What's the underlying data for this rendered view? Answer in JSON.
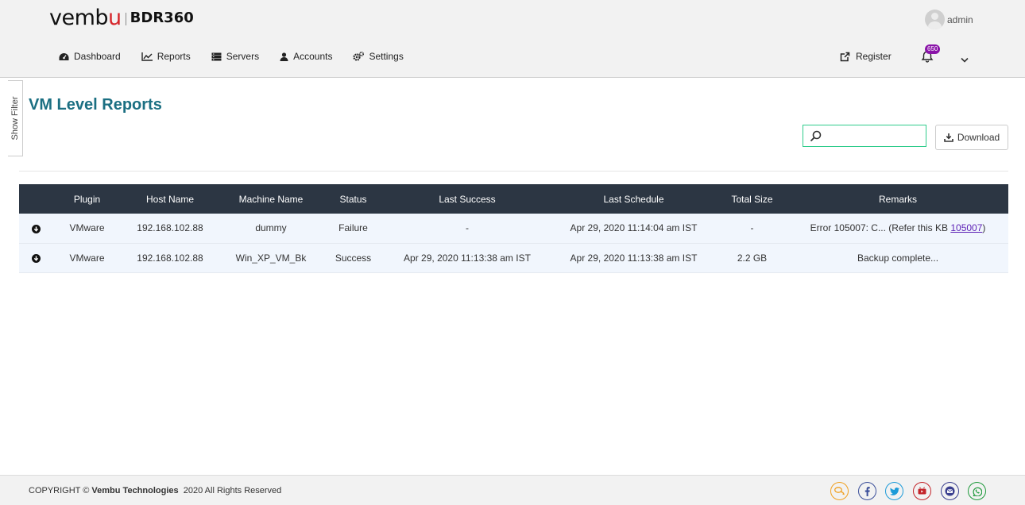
{
  "header": {
    "logo_text_left": "vemb",
    "logo_text_u": "u",
    "logo_product": "BDR360",
    "user_name": "admin"
  },
  "nav": {
    "items": [
      {
        "label": "Dashboard",
        "icon": "dashboard-icon"
      },
      {
        "label": "Reports",
        "icon": "line-chart-icon"
      },
      {
        "label": "Servers",
        "icon": "server-icon"
      },
      {
        "label": "Accounts",
        "icon": "user-icon"
      },
      {
        "label": "Settings",
        "icon": "cogs-icon"
      }
    ],
    "register_label": "Register",
    "notification_count": "650"
  },
  "filter": {
    "label": "Show Filter"
  },
  "page": {
    "title": "VM Level Reports"
  },
  "search": {
    "placeholder": "",
    "value": ""
  },
  "toolbar": {
    "download_label": "Download"
  },
  "table": {
    "columns": [
      "Plugin",
      "Host Name",
      "Machine Name",
      "Status",
      "Last Success",
      "Last Schedule",
      "Total Size",
      "Remarks"
    ],
    "rows": [
      {
        "plugin": "VMware",
        "host": "192.168.102.88",
        "machine": "dummy",
        "status": "Failure",
        "last_success": "-",
        "last_schedule": "Apr 29, 2020 11:14:04 am IST",
        "size": "-",
        "remarks_prefix": "Error 105007: C... (Refer this KB ",
        "remarks_link": "105007",
        "remarks_suffix": ")"
      },
      {
        "plugin": "VMware",
        "host": "192.168.102.88",
        "machine": "Win_XP_VM_Bk",
        "status": "Success",
        "last_success": "Apr 29, 2020 11:13:38 am IST",
        "last_schedule": "Apr 29, 2020 11:13:38 am IST",
        "size": "2.2 GB",
        "remarks_prefix": "Backup complete...",
        "remarks_link": "",
        "remarks_suffix": ""
      }
    ]
  },
  "footer": {
    "copyright_prefix": "COPYRIGHT ©",
    "company": "Vembu Technologies",
    "copyright_suffix": "2020 All Rights Reserved",
    "social": [
      {
        "name": "chat-icon",
        "color": "#f0a020"
      },
      {
        "name": "facebook-icon",
        "color": "#3b4f9a"
      },
      {
        "name": "twitter-icon",
        "color": "#1d9bd8"
      },
      {
        "name": "youtube-icon",
        "color": "#c4262c"
      },
      {
        "name": "email-icon",
        "color": "#3b3f8f"
      },
      {
        "name": "whatsapp-icon",
        "color": "#1f9a3c"
      }
    ]
  },
  "colors": {
    "header_bg": "#f2f2f2",
    "title": "#1b6f82",
    "table_header_bg": "#2c3643",
    "row_bg": "#f1f6fd",
    "search_border": "#2fcc8c",
    "badge": "#8a14a8",
    "link": "#5b1fb5"
  }
}
